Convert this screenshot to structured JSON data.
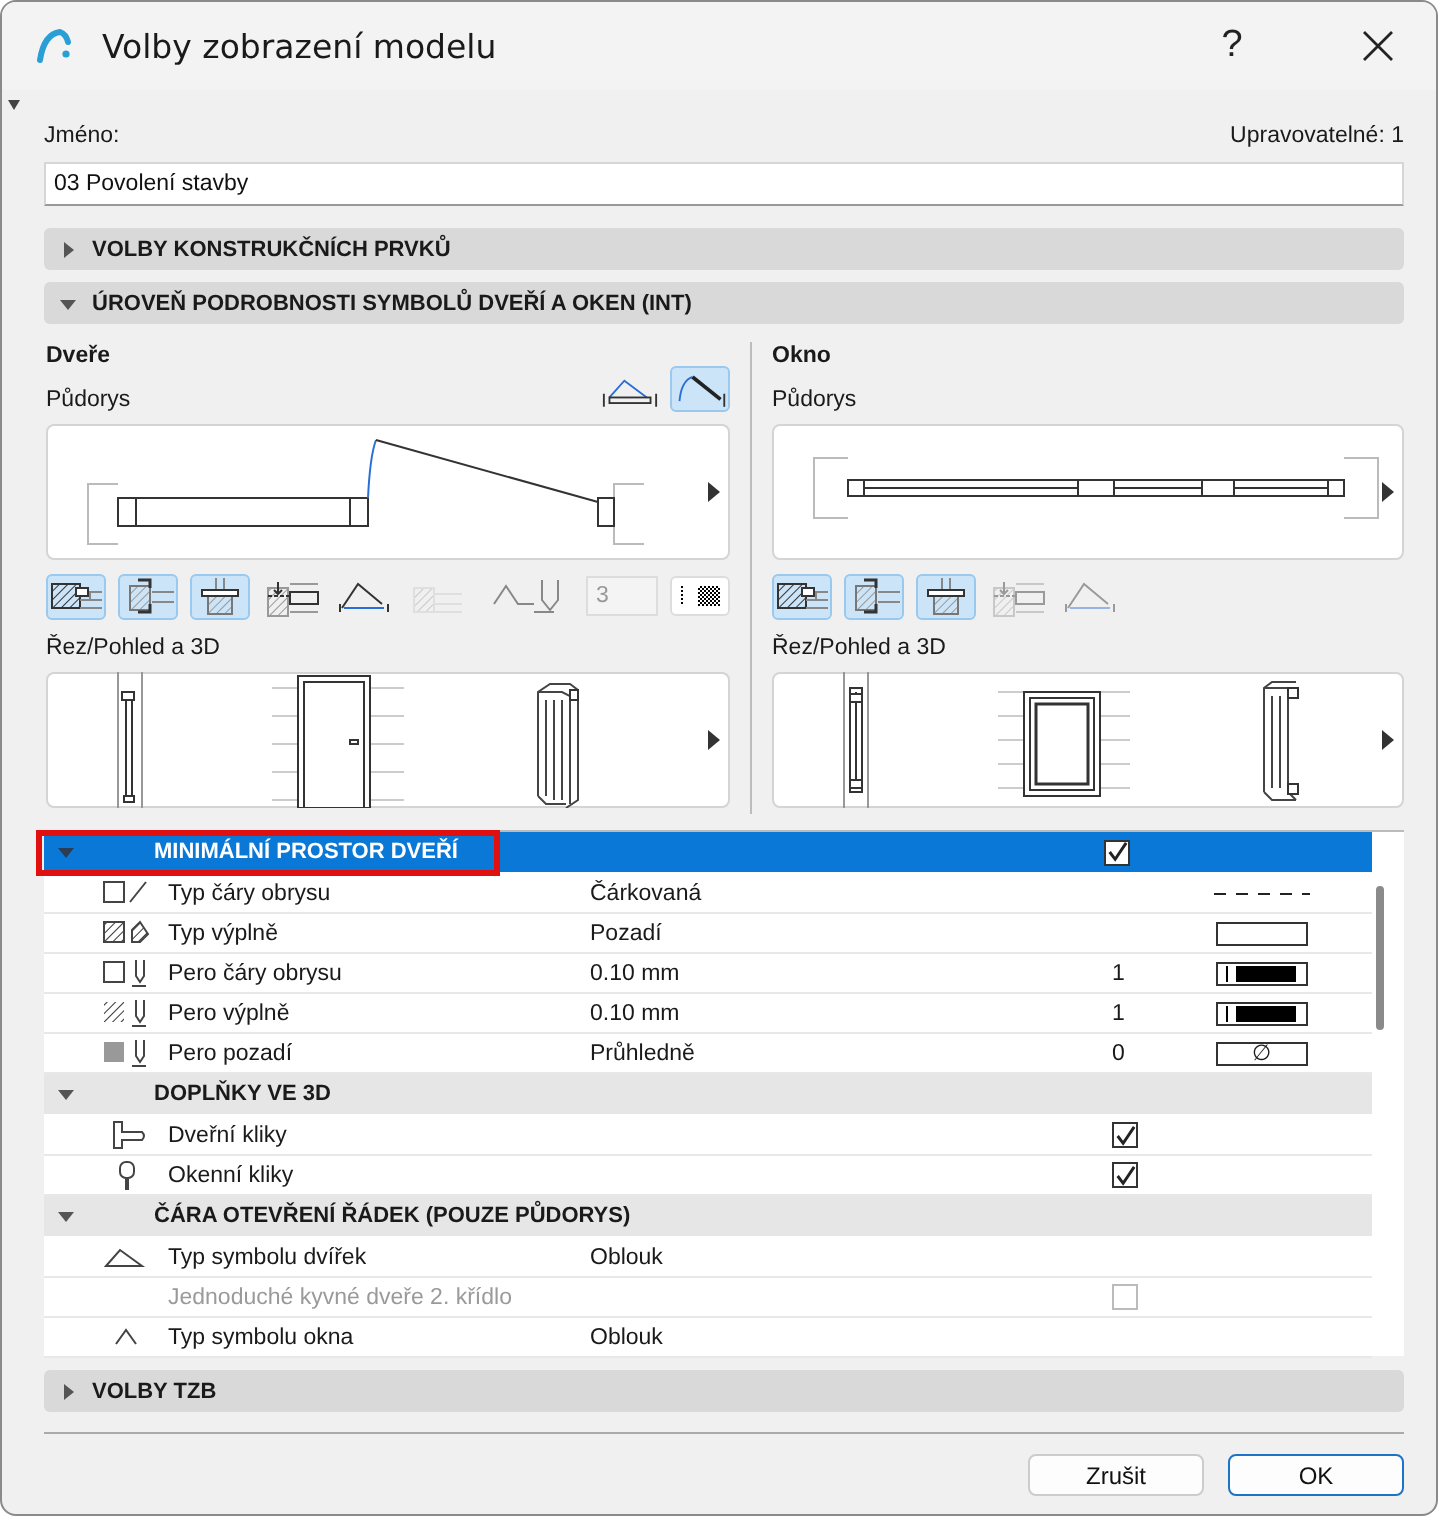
{
  "window": {
    "title": "Volby zobrazení modelu",
    "help": "?"
  },
  "name_field": {
    "label": "Jméno:",
    "counter": "Upravovatelné: 1",
    "value": "03 Povolení stavby"
  },
  "top_sections": [
    {
      "label": "VOLBY KONSTRUKČNÍCH PRVKŮ",
      "expanded": false
    },
    {
      "label": "ÚROVEŇ PODROBNOSTI SYMBOLŮ DVEŘÍ A OKEN (INT)",
      "expanded": true
    }
  ],
  "panels": [
    {
      "kind": "door",
      "title": "Dveře",
      "plan_label": "Půdorys",
      "symbol_styles": [
        {
          "selected": false
        },
        {
          "selected": true
        }
      ],
      "tools": [
        {
          "selected": true,
          "disabled": false
        },
        {
          "selected": true,
          "disabled": false
        },
        {
          "selected": true,
          "disabled": false
        },
        {
          "selected": false,
          "disabled": false
        },
        {
          "selected": false,
          "disabled": false
        },
        {
          "selected": false,
          "disabled": true
        }
      ],
      "pen_field": "3",
      "section_label": "Řez/Pohled a 3D"
    },
    {
      "kind": "window",
      "title": "Okno",
      "plan_label": "Půdorys",
      "tools": [
        {
          "selected": true,
          "disabled": false
        },
        {
          "selected": true,
          "disabled": false
        },
        {
          "selected": true,
          "disabled": false
        },
        {
          "selected": false,
          "disabled": true
        },
        {
          "selected": false,
          "disabled": true
        }
      ],
      "section_label": "Řez/Pohled a 3D"
    }
  ],
  "table": {
    "sections": [
      {
        "label": "MINIMÁLNÍ PROSTOR DVEŘÍ",
        "expanded": true,
        "selected": true,
        "highlighted": true,
        "checked": true,
        "rows": [
          {
            "kind": "value",
            "label": "Typ čáry obrysu",
            "value": "Čárkovaná",
            "disabled": false,
            "swatch": {
              "kind": "dashes"
            }
          },
          {
            "kind": "value",
            "label": "Typ výplně",
            "value": "Pozadí",
            "disabled": false,
            "swatch": {
              "kind": "blank"
            }
          },
          {
            "kind": "value",
            "label": "Pero čáry obrysu",
            "value": "0.10 mm",
            "number": "1",
            "disabled": false,
            "swatch": {
              "kind": "pen"
            }
          },
          {
            "kind": "value",
            "label": "Pero výplně",
            "value": "0.10 mm",
            "number": "1",
            "disabled": false,
            "swatch": {
              "kind": "pen"
            }
          },
          {
            "kind": "value",
            "label": "Pero pozadí",
            "value": "Průhledně",
            "number": "0",
            "disabled": false,
            "swatch": {
              "kind": "symbol",
              "text": "∅"
            }
          }
        ]
      },
      {
        "label": "DOPLŇKY VE 3D",
        "expanded": true,
        "selected": false,
        "highlighted": false,
        "rows": [
          {
            "kind": "check",
            "label": "Dveřní kliky",
            "checked": true,
            "disabled": false
          },
          {
            "kind": "check",
            "label": "Okenní kliky",
            "checked": true,
            "disabled": false
          }
        ]
      },
      {
        "label": "ČÁRA OTEVŘENÍ ŘÁDEK (POUZE PŮDORYS)",
        "expanded": true,
        "selected": false,
        "highlighted": false,
        "rows": [
          {
            "kind": "value",
            "label": "Typ symbolu dvířek",
            "value": "Oblouk",
            "disabled": false
          },
          {
            "kind": "check",
            "label": "Jednoduché kyvné dveře 2. křídlo",
            "checked": false,
            "disabled": true
          },
          {
            "kind": "value",
            "label": "Typ symbolu okna",
            "value": "Oblouk",
            "disabled": false
          }
        ]
      }
    ]
  },
  "bottom_section": {
    "label": "VOLBY TZB",
    "expanded": false
  },
  "buttons": [
    {
      "label": "Zrušit",
      "default": false
    },
    {
      "label": "OK",
      "default": true
    }
  ]
}
